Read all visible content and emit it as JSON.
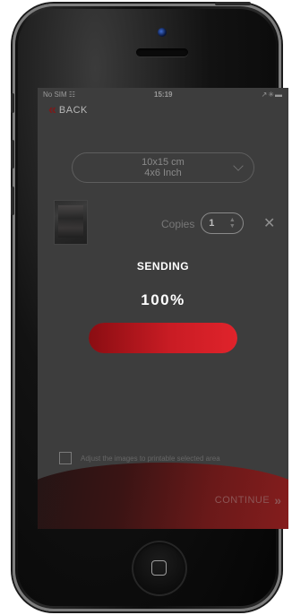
{
  "status_bar": {
    "carrier": "No SIM",
    "wifi_icon": "wifi-icon",
    "time": "15:19",
    "right_icons": "location-icon bluetooth-icon battery-icon"
  },
  "nav": {
    "back_label": "BACK",
    "back_icon": "double-chevron-left-icon"
  },
  "print_size": {
    "line1": "10x15 cm",
    "line2": "4x6 Inch"
  },
  "copies": {
    "label": "Copies",
    "value": "1"
  },
  "overlay": {
    "status": "SENDING",
    "progress_text": "100%",
    "progress": 1.0
  },
  "adjust": {
    "label": "Adjust the images to printable selected area"
  },
  "footer": {
    "continue_label": "CONTINUE"
  },
  "colors": {
    "accent": "#d01f26",
    "screen_bg": "#3d3d3d"
  }
}
